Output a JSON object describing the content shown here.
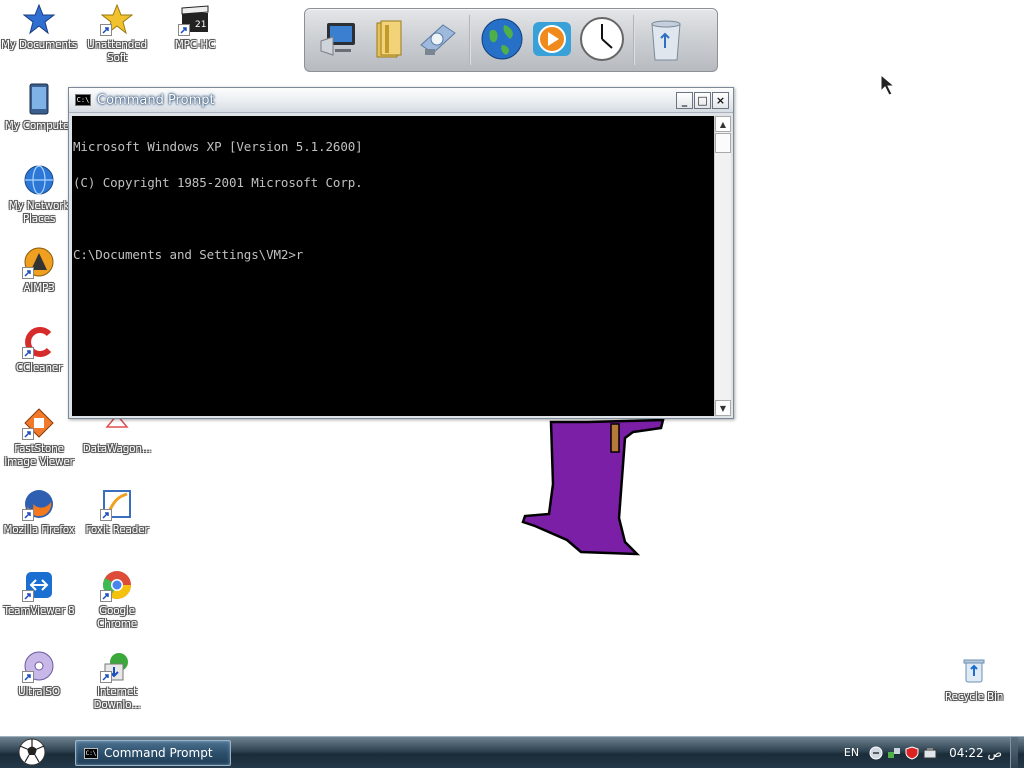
{
  "desktop": {
    "icons": [
      {
        "label": "My Documents",
        "icon": "star-documents-icon"
      },
      {
        "label": "Unattended Soft",
        "icon": "star-shortcut-icon"
      },
      {
        "label": "MPC-HC",
        "icon": "clapperboard-icon"
      },
      {
        "label": "My Computer",
        "icon": "computer-icon"
      },
      {
        "label": "My Network Places",
        "icon": "globe-network-icon"
      },
      {
        "label": "AIMP3",
        "icon": "aimp-icon"
      },
      {
        "label": "CCleaner",
        "icon": "ccleaner-icon"
      },
      {
        "label": "FastStone Image Viewer",
        "icon": "faststone-icon"
      },
      {
        "label": "DataWagon...",
        "icon": "datawagon-icon"
      },
      {
        "label": "Mozilla Firefox",
        "icon": "firefox-icon"
      },
      {
        "label": "Foxit Reader",
        "icon": "foxit-icon"
      },
      {
        "label": "TeamViewer 8",
        "icon": "teamviewer-icon"
      },
      {
        "label": "Google Chrome",
        "icon": "chrome-icon"
      },
      {
        "label": "UltraISO",
        "icon": "disc-icon"
      },
      {
        "label": "Internet Downlo...",
        "icon": "download-manager-icon"
      },
      {
        "label": "Recycle Bin",
        "icon": "recycle-bin-icon"
      }
    ]
  },
  "dock": {
    "items": [
      "computer-icon",
      "folder-icon",
      "control-panel-icon",
      "globe-icon",
      "media-player-icon",
      "clock-icon",
      "trash-icon"
    ]
  },
  "window": {
    "title": "Command Prompt",
    "min_label": "_",
    "max_label": "□",
    "close_label": "×",
    "console_lines": [
      "Microsoft Windows XP [Version 5.1.2600]",
      "(C) Copyright 1985-2001 Microsoft Corp.",
      "",
      "C:\\Documents and Settings\\VM2>r"
    ]
  },
  "taskbar": {
    "task_label": "Command Prompt",
    "language": "EN",
    "clock": "04:22 ص"
  },
  "colors": {
    "console_bg": "#000000",
    "console_text": "#c0c0c0",
    "figure_purple": "#7a1fa6"
  }
}
